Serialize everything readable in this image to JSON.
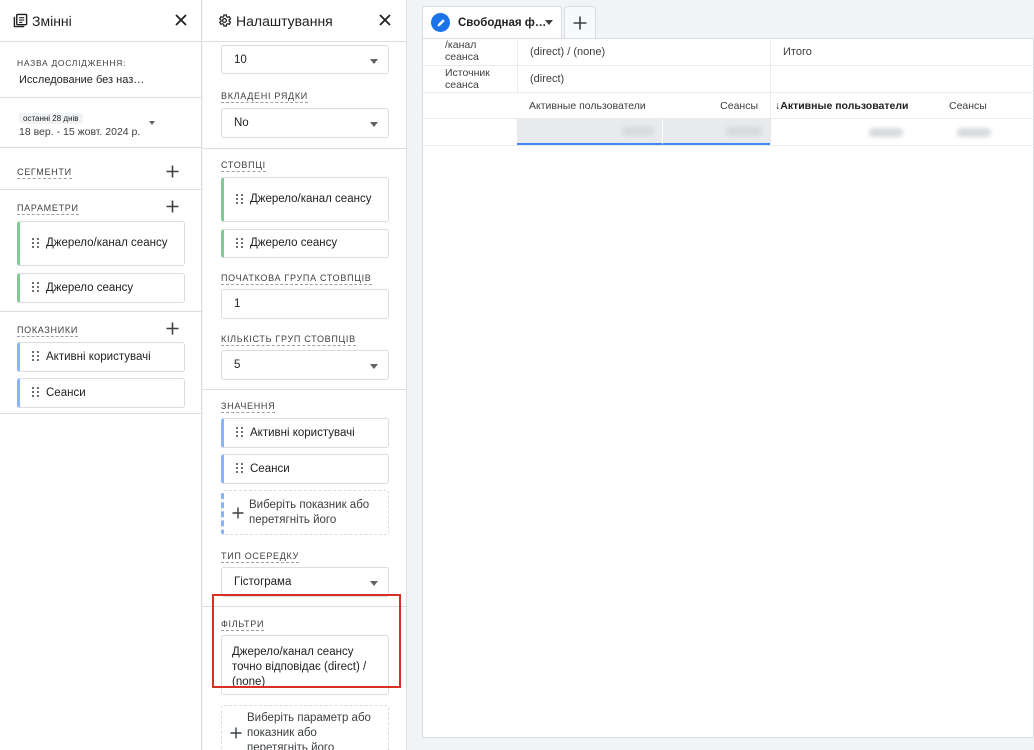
{
  "variables_panel": {
    "title": "Змінні",
    "exploration_name_label": "НАЗВА ДОСЛІДЖЕННЯ:",
    "exploration_name_value": "Исследование без наз…",
    "date_badge": "останні 28 днів",
    "date_range": "18 вер. - 15 жовт. 2024 р.",
    "segments_label": "СЕГМЕНТИ",
    "dimensions_label": "ПАРАМЕТРИ",
    "dimensions": [
      {
        "label": "Джерело/канал сеансу"
      },
      {
        "label": "Джерело сеансу"
      }
    ],
    "metrics_label": "ПОКАЗНИКИ",
    "metrics": [
      {
        "label": "Активні користувачі"
      },
      {
        "label": "Сеанси"
      }
    ]
  },
  "settings_panel": {
    "title": "Налаштування",
    "rows_count_value": "10",
    "nested_rows_label": "ВКЛАДЕНІ РЯДКИ",
    "nested_rows_value": "No",
    "columns_label": "СТОВПЦІ",
    "columns": [
      {
        "label": "Джерело/канал сеансу"
      },
      {
        "label": "Джерело сеансу"
      }
    ],
    "start_col_group_label": "ПОЧАТКОВА ГРУПА СТОВПЦІВ",
    "start_col_group_value": "1",
    "col_groups_count_label": "КІЛЬКІСТЬ ГРУП СТОВПЦІВ",
    "col_groups_count_value": "5",
    "values_label": "ЗНАЧЕННЯ",
    "values": [
      {
        "label": "Активні користувачі"
      },
      {
        "label": "Сеанси"
      }
    ],
    "add_metric_text": "Виберіть показник або перетягніть його",
    "cell_type_label": "ТИП ОСЕРЕДКУ",
    "cell_type_value": "Гістограма",
    "filters_label": "ФІЛЬТРИ",
    "filter_text": "Джерело/канал сеансу точно відповідає (direct) / (none)",
    "add_filter_text": "Виберіть параметр або показник або перетягніть його"
  },
  "main": {
    "tab_label": "Свободная ф…",
    "header_dim1": "/канал сеанса",
    "header_dim2": "Источник сеанса",
    "col_val1": "(direct) / (none)",
    "col_val2": "(direct)",
    "total_label": "Итого",
    "metric1": "Активные пользователи",
    "metric2": "Сеансы",
    "metric1_total": "Активные пользователи",
    "metric2_total": "Сеансы",
    "sort_arrow": "↓"
  }
}
